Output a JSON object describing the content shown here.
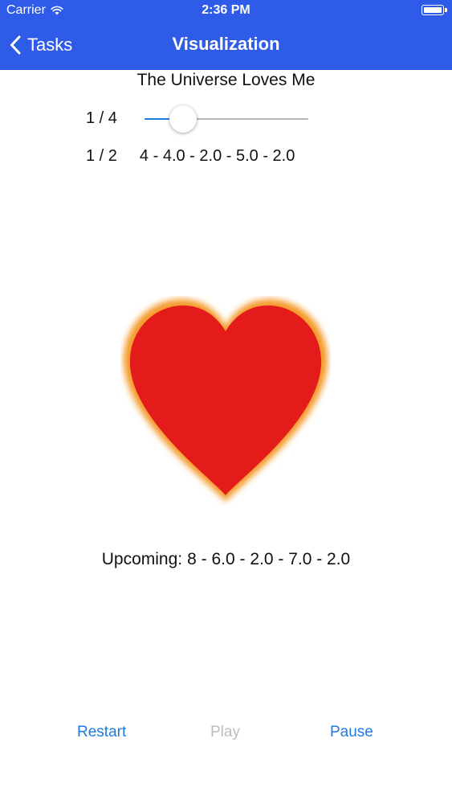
{
  "status_bar": {
    "carrier": "Carrier",
    "time": "2:36 PM",
    "icons": [
      "wifi-icon",
      "battery-icon"
    ]
  },
  "nav": {
    "back_label": "Tasks",
    "back_icon": "chevron-left-icon",
    "title": "Visualization",
    "bar_color": "#2e5be8"
  },
  "task": {
    "title": "The Universe Loves Me",
    "slider_label": "1 / 4",
    "slider_value": 0.15,
    "step_label": "1 / 2",
    "step_pattern": "4 - 4.0 - 2.0 - 5.0 - 2.0"
  },
  "visual": {
    "icon": "heart-icon",
    "fill_color": "#e31b1b",
    "glow_color": "#f59a2b"
  },
  "upcoming": {
    "label": "Upcoming:",
    "pattern": "8 - 6.0 - 2.0 - 7.0 - 2.0"
  },
  "controls": {
    "restart": "Restart",
    "play": "Play",
    "pause": "Pause",
    "accent": "#1f7ae0"
  }
}
